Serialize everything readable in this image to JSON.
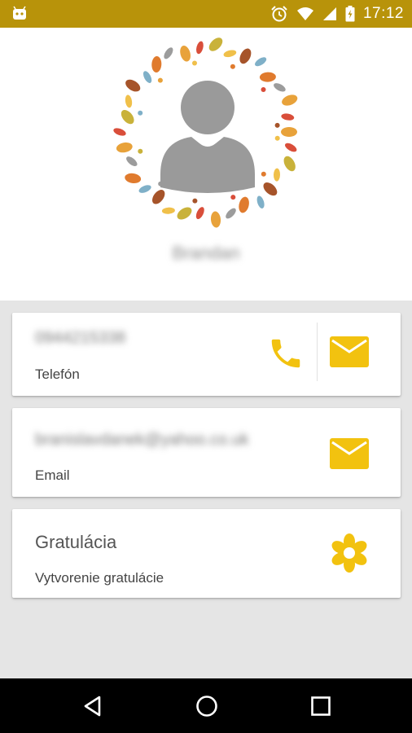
{
  "status_bar": {
    "time": "17:12",
    "icons": [
      "android-icon",
      "alarm-icon",
      "wifi-icon",
      "signal-icon",
      "battery-icon"
    ]
  },
  "contact": {
    "name": "Brandan"
  },
  "phone_card": {
    "value": "0944215338",
    "label": "Telefón"
  },
  "email_card": {
    "value": "branislavdanek@yahoo.co.uk",
    "label": "Email"
  },
  "greeting_card": {
    "title": "Gratulácia",
    "subtitle": "Vytvorenie gratulácie"
  },
  "colors": {
    "status_bar": "#b8930a",
    "accent": "#f2c20f",
    "background": "#e5e5e5",
    "navbar": "#000000"
  }
}
